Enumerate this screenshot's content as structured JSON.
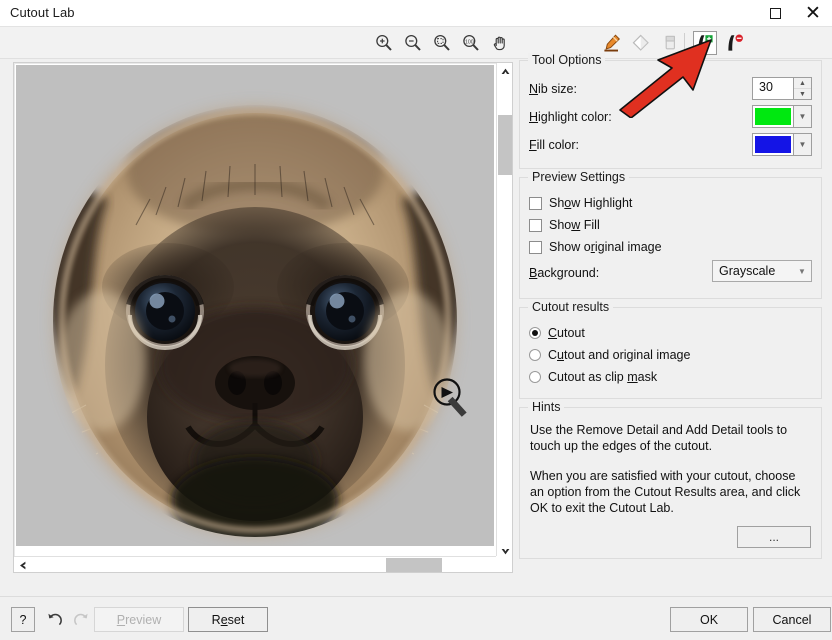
{
  "window": {
    "title": "Cutout Lab",
    "maximize_label": "Maximize",
    "close_label": "Close"
  },
  "toolbar": {
    "items": [
      {
        "name": "zoom-in-icon",
        "tooltip": "Zoom In",
        "selected": false
      },
      {
        "name": "zoom-out-icon",
        "tooltip": "Zoom Out",
        "selected": false
      },
      {
        "name": "zoom-fit-icon",
        "tooltip": "Zoom To Fit",
        "selected": false
      },
      {
        "name": "zoom-100-icon",
        "tooltip": "Zoom To 100%",
        "selected": false
      },
      {
        "name": "pan-hand-icon",
        "tooltip": "Pan",
        "selected": false
      },
      {
        "name": "highlighter-icon",
        "tooltip": "Highlighter",
        "selected": false
      },
      {
        "name": "fill-bucket-icon",
        "tooltip": "Fill",
        "selected": false
      },
      {
        "name": "eraser-icon",
        "tooltip": "Eraser",
        "selected": false
      },
      {
        "name": "add-detail-icon",
        "tooltip": "Add Detail",
        "selected": true
      },
      {
        "name": "remove-detail-icon",
        "tooltip": "Remove Detail",
        "selected": false
      }
    ],
    "zoom_100_label": "100"
  },
  "canvas": {
    "image_alt": "pug dog face cutout preview",
    "cursor": "magnifier-cursor",
    "vscroll_up": "▲",
    "vscroll_down": "▼",
    "hscroll_left": "❮",
    "hscroll_right": "❯"
  },
  "tool_options": {
    "legend": "Tool Options",
    "nib_size": {
      "label": "Nib size:",
      "accel": "N",
      "value": "30"
    },
    "highlight_color": {
      "label": "Highlight color:",
      "accel": "H",
      "value": "#00E810"
    },
    "fill_color": {
      "label": "Fill color:",
      "accel": "F",
      "value": "#1414E6"
    }
  },
  "preview_settings": {
    "legend": "Preview Settings",
    "checkboxes": [
      {
        "label": "Show Highlight",
        "accel": "o",
        "checked": false
      },
      {
        "label": "Show Fill",
        "accel": "w",
        "checked": false
      },
      {
        "label": "Show original image",
        "accel": "r",
        "checked": false
      }
    ],
    "background": {
      "label": "Background:",
      "accel": "B",
      "value": "Grayscale"
    }
  },
  "cutout_results": {
    "legend": "Cutout results",
    "options": [
      {
        "label": "Cutout",
        "accel": "C",
        "selected": true
      },
      {
        "label": "Cutout and original image",
        "accel": "u",
        "selected": false
      },
      {
        "label": "Cutout as clip mask",
        "accel": "m",
        "selected": false
      }
    ]
  },
  "hints": {
    "legend": "Hints",
    "paragraph1": "Use the Remove Detail and Add Detail tools to touch up the edges of the cutout.",
    "paragraph2": "When you are satisfied with your cutout, choose an option from the Cutout Results area, and click OK to exit the Cutout Lab.",
    "more_button": "..."
  },
  "bottom_bar": {
    "help": "?",
    "undo": "undo-icon",
    "redo": "redo-icon",
    "preview": "Preview",
    "preview_accel": "P",
    "preview_disabled": true,
    "reset": "Reset",
    "reset_accel": "e",
    "ok": "OK",
    "cancel": "Cancel"
  },
  "annotation": {
    "type": "red-arrow",
    "color": "#E03020",
    "points_to": "add-detail-icon"
  }
}
